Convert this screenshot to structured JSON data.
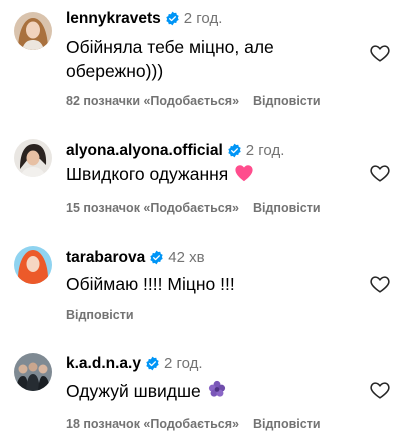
{
  "comments": [
    {
      "username": "lennykravets",
      "time": "2 год.",
      "text_line1": "Обійняла тебе міцно, але",
      "text_line2": "обережно)))",
      "likes": "82 позначки «Подобається»",
      "reply": "Відповісти",
      "avatar": "woman-portrait-avatar"
    },
    {
      "username": "alyona.alyona.official",
      "time": "2 год.",
      "text": "Швидкого одужання",
      "emoji": "pink-heart-emoji",
      "likes": "15 позначок «Подобається»",
      "reply": "Відповісти",
      "avatar": "woman-dark-hair-avatar"
    },
    {
      "username": "tarabarova",
      "time": "42 хв",
      "text": "Обіймаю !!!! Міцно !!!",
      "reply": "Відповісти",
      "avatar": "woman-red-hair-avatar"
    },
    {
      "username": "k.a.d.n.a.y",
      "time": "2 год.",
      "text": "Одужуй швидше",
      "emoji": "purple-flower-emoji",
      "likes": "18 позначок «Подобається»",
      "reply": "Відповісти",
      "avatar": "group-photo-avatar"
    }
  ],
  "colors": {
    "verified": "#0095f6",
    "meta": "#737373",
    "pink_heart": "#ff4d8d",
    "purple": "#7a57b8"
  }
}
